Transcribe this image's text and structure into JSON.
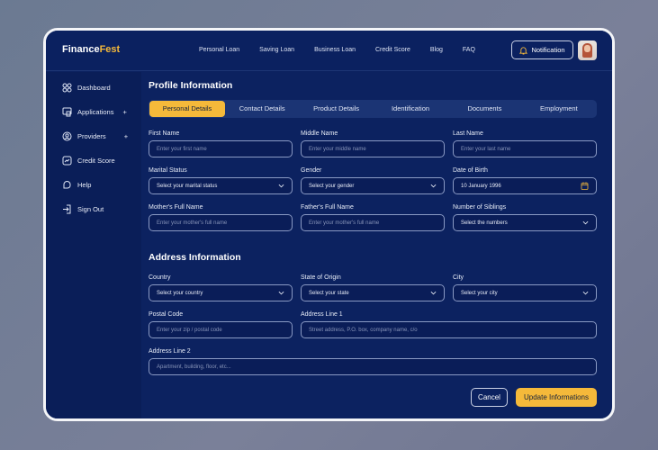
{
  "brand": {
    "name_a": "Finance",
    "name_b": "Fest"
  },
  "nav": [
    "Personal Loan",
    "Saving Loan",
    "Business Loan",
    "Credit Score",
    "Blog",
    "FAQ"
  ],
  "notification_label": "Notification",
  "sidebar": [
    {
      "label": "Dashboard",
      "icon": "grid-icon"
    },
    {
      "label": "Applications",
      "icon": "applications-icon",
      "plus": "+"
    },
    {
      "label": "Providers",
      "icon": "user-circle-icon",
      "plus": "+"
    },
    {
      "label": "Credit Score",
      "icon": "chart-icon"
    },
    {
      "label": "Help",
      "icon": "help-icon"
    },
    {
      "label": "Sign Out",
      "icon": "signout-icon"
    }
  ],
  "profile": {
    "title": "Profile Information",
    "tabs": [
      "Personal Details",
      "Contact Details",
      "Product Details",
      "Identification",
      "Documents",
      "Employment"
    ],
    "fields": [
      {
        "label": "First Name",
        "placeholder": "Enter your first name"
      },
      {
        "label": "Middle Name",
        "placeholder": "Enter your middle name"
      },
      {
        "label": "Last Name",
        "placeholder": "Enter your last name"
      },
      {
        "label": "Marital Status",
        "value": "Select your marital status"
      },
      {
        "label": "Gender",
        "value": "Select your gender"
      },
      {
        "label": "Date of Birth",
        "value": "10 January 1996"
      },
      {
        "label": "Mother's Full Name",
        "placeholder": "Enter your mother's full name"
      },
      {
        "label": "Father's Full Name",
        "placeholder": "Enter your mother's full name"
      },
      {
        "label": "Number of Siblings",
        "value": "Select the numbers"
      }
    ]
  },
  "address": {
    "title": "Address Information",
    "fields": [
      {
        "label": "Country",
        "value": "Select your country"
      },
      {
        "label": "State of Origin",
        "value": "Select your state"
      },
      {
        "label": "City",
        "value": "Select your city"
      },
      {
        "label": "Postal Code",
        "placeholder": "Enter your zip / postal code"
      },
      {
        "label": "Address Line 1",
        "placeholder": "Street address, P.O. box, company name, c/o"
      },
      {
        "label": "Address Line 2",
        "placeholder": "Apartment, building, floor, etc..."
      }
    ]
  },
  "buttons": {
    "cancel": "Cancel",
    "update": "Update Informations"
  },
  "colors": {
    "accent": "#f5b93a",
    "bg": "#0c2260"
  }
}
